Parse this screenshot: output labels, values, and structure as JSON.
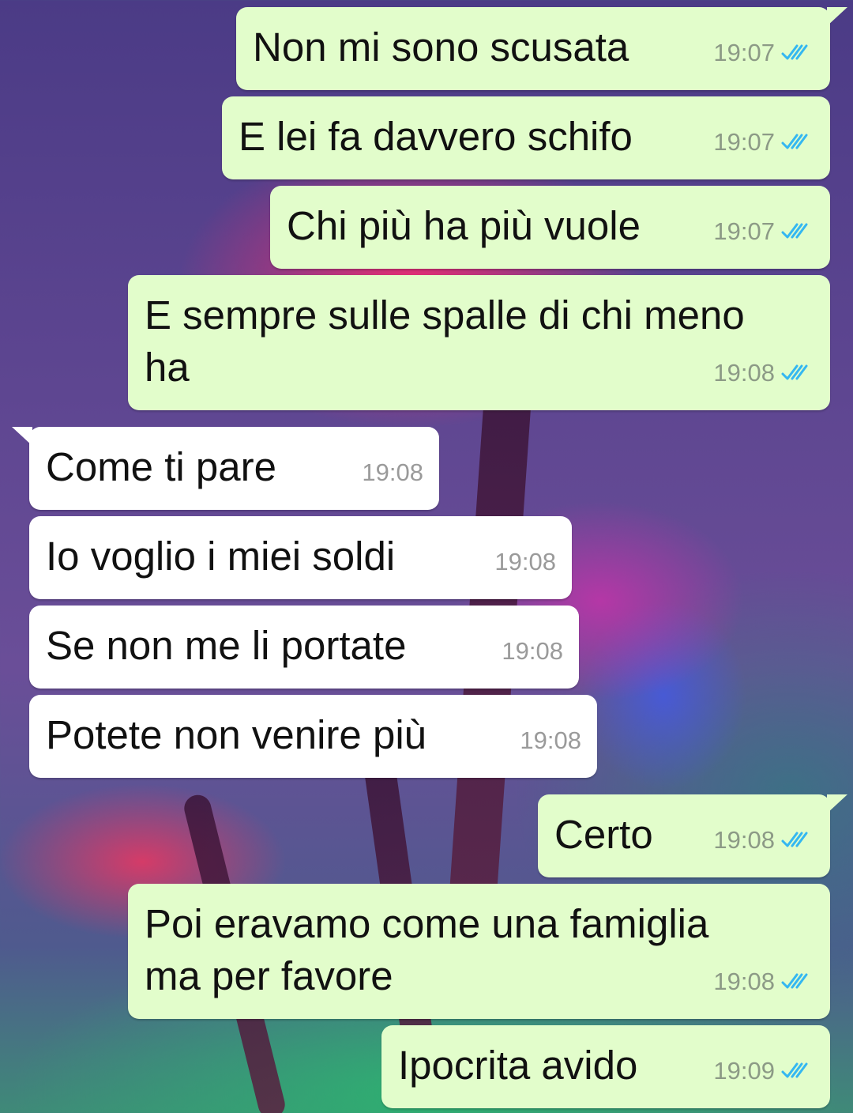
{
  "messages": [
    {
      "text": "Non mi sono scusata",
      "time": "19:07",
      "status": "read-double-check-icon"
    },
    {
      "text": "E lei fa davvero schifo",
      "time": "19:07",
      "status": "read-double-check-icon"
    },
    {
      "text": "Chi più ha più vuole",
      "time": "19:07",
      "status": "read-double-check-icon"
    },
    {
      "text_line1": "E sempre sulle spalle di chi meno",
      "text_line2": "ha",
      "time": "19:08",
      "status": "read-double-check-icon"
    },
    {
      "text": "Come ti pare",
      "time": "19:08"
    },
    {
      "text": "Io voglio i miei soldi",
      "time": "19:08"
    },
    {
      "text": "Se non me li portate",
      "time": "19:08"
    },
    {
      "text": "Potete non venire più",
      "time": "19:08"
    },
    {
      "text": "Certo",
      "time": "19:08",
      "status": "read-double-check-icon"
    },
    {
      "text_line1": "Poi eravamo come una famiglia",
      "text_line2": "ma per favore",
      "time": "19:08",
      "status": "read-double-check-icon"
    },
    {
      "text": "Ipocrita avido",
      "time": "19:09",
      "status": "read-double-check-icon"
    }
  ],
  "colors": {
    "outgoing_bubble": "#e2fdcb",
    "incoming_bubble": "#ffffff",
    "read_tick": "#34b7f1"
  }
}
